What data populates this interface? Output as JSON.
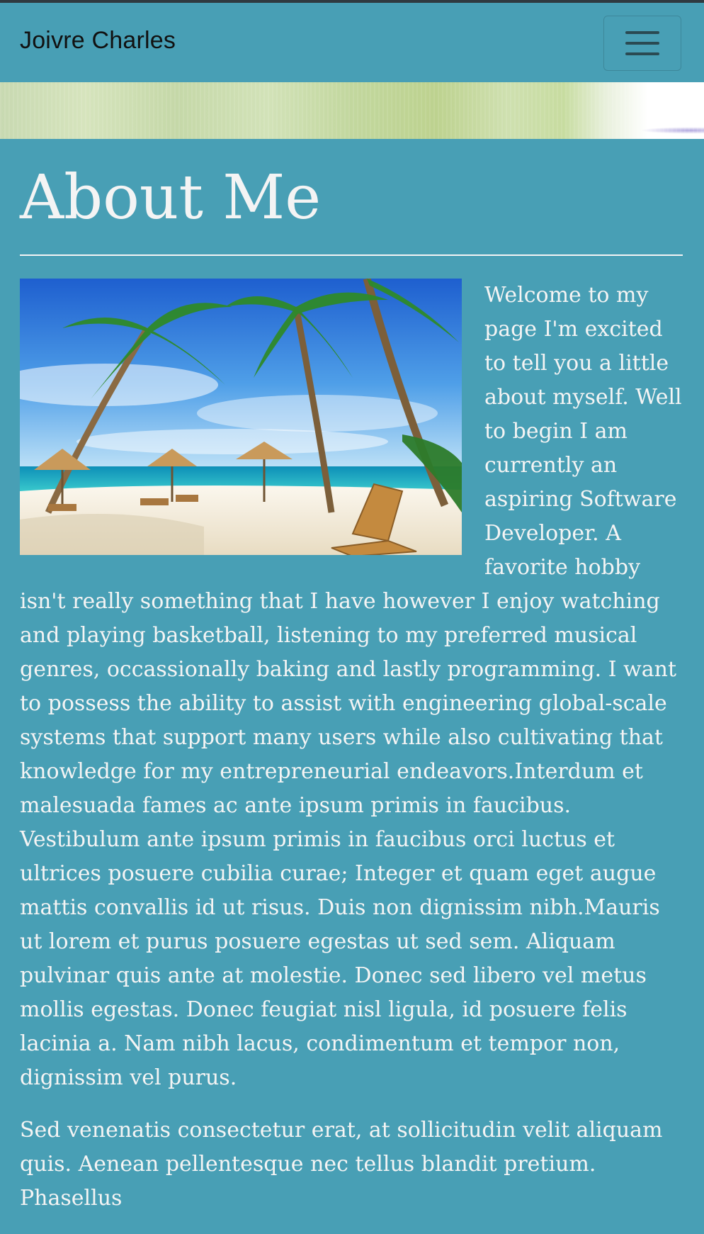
{
  "navbar": {
    "brand": "Joivre Charles",
    "menu_icon": "hamburger-menu-icon"
  },
  "main": {
    "title": "About Me",
    "photo_alt": "beach-photo",
    "paragraphs": [
      "Welcome to my page I'm excited to tell you a little about myself. Well to begin I am currently an aspiring Software Developer. A favorite hobby isn't really something that I have however I enjoy watching and playing basketball, listening to my preferred musical genres, occassionally baking and lastly programming. I want to possess the ability to assist with engineering global-scale systems that support many users while also cultivating that knowledge for my entrepreneurial endeavors.Interdum et malesuada fames ac ante ipsum primis in faucibus. Vestibulum ante ipsum primis in faucibus orci luctus et ultrices posuere cubilia curae; Integer et quam eget augue mattis convallis id ut risus. Duis non dignissim nibh.Mauris ut lorem et purus posuere egestas ut sed sem. Aliquam pulvinar quis ante at molestie. Donec sed libero vel metus mollis egestas. Donec feugiat nisl ligula, id posuere felis lacinia a. Nam nibh lacus, condimentum et tempor non, dignissim vel purus.",
      "Sed venenatis consectetur erat, at sollicitudin velit aliquam quis. Aenean pellentesque nec tellus blandit pretium. Phasellus"
    ]
  },
  "colors": {
    "background": "#489fb5",
    "text": "#f4f4f4",
    "brand_text": "#111111"
  }
}
